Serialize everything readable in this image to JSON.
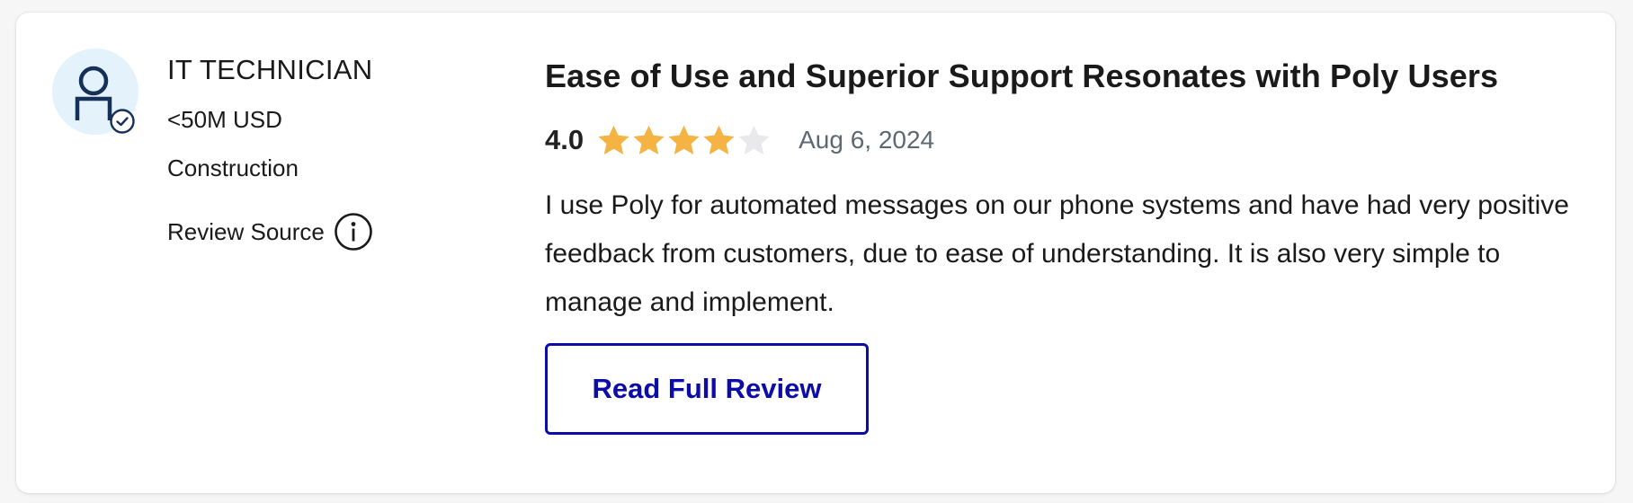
{
  "reviewer": {
    "role": "IT TECHNICIAN",
    "company_size": "<50M USD",
    "industry": "Construction",
    "review_source_label": "Review Source",
    "avatar_icon": "person-icon",
    "verified_icon": "verified-check-icon",
    "info_icon": "info-icon"
  },
  "review": {
    "title": "Ease of Use and Superior Support Resonates with Poly Users",
    "rating_text": "4.0",
    "rating": 4,
    "rating_max": 5,
    "date": "Aug 6, 2024",
    "body": "I use Poly for automated messages on our phone systems and have had very positive feedback from customers, due to ease of understanding. It is also very simple to manage and implement.",
    "read_more_label": "Read Full Review"
  },
  "colors": {
    "star_filled": "#f4b342",
    "star_empty": "#e9e9ec",
    "button_accent": "#0c0ca8",
    "avatar_bg": "#e3f2fb",
    "avatar_icon": "#17305a",
    "date_text": "#5d6874"
  }
}
